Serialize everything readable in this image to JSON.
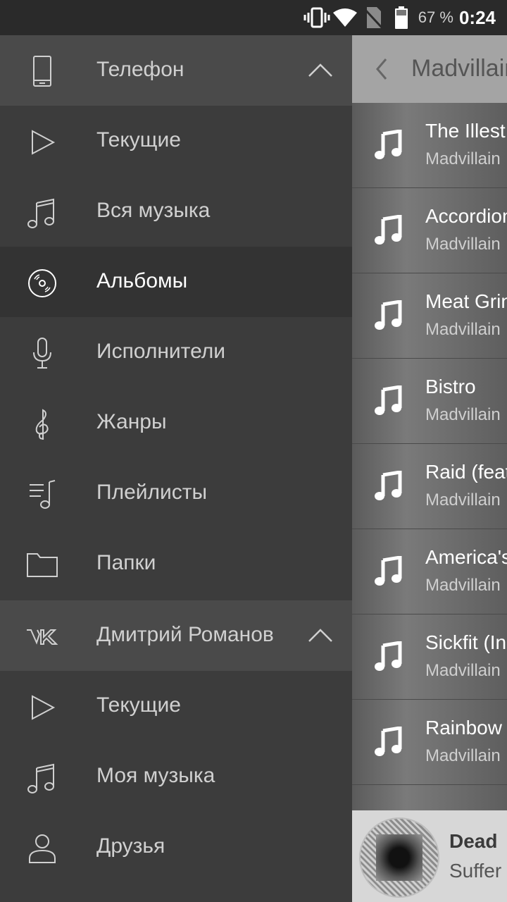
{
  "status_bar": {
    "battery_percent": "67 %",
    "time": "0:24",
    "icons": [
      "vibrate-icon",
      "wifi-icon",
      "no-sim-icon",
      "battery-icon"
    ]
  },
  "background": {
    "toolbar_title": "Madvillain",
    "tracks": [
      {
        "title": "The Illest",
        "artist": "Madvillain"
      },
      {
        "title": "Accordion",
        "artist": "Madvillain"
      },
      {
        "title": "Meat Grinder",
        "artist": "Madvillain"
      },
      {
        "title": "Bistro",
        "artist": "Madvillain"
      },
      {
        "title": "Raid (feat",
        "artist": "Madvillain"
      },
      {
        "title": "America's",
        "artist": "Madvillain"
      },
      {
        "title": "Sickfit (In",
        "artist": "Madvillain"
      },
      {
        "title": "Rainbow",
        "artist": "Madvillain"
      }
    ],
    "mini_player": {
      "title": "Dead",
      "subtitle": "Suffer"
    }
  },
  "drawer": {
    "phone_section": {
      "header": "Телефон",
      "items": [
        {
          "label": "Текущие",
          "icon": "play-icon"
        },
        {
          "label": "Вся музыка",
          "icon": "music-note-icon"
        },
        {
          "label": "Альбомы",
          "icon": "vinyl-icon",
          "selected": true
        },
        {
          "label": "Исполнители",
          "icon": "microphone-icon"
        },
        {
          "label": "Жанры",
          "icon": "treble-clef-icon"
        },
        {
          "label": "Плейлисты",
          "icon": "playlist-icon"
        },
        {
          "label": "Папки",
          "icon": "folder-icon"
        }
      ]
    },
    "vk_section": {
      "header": "Дмитрий Романов",
      "items": [
        {
          "label": "Текущие",
          "icon": "play-icon"
        },
        {
          "label": "Моя музыка",
          "icon": "music-note-icon"
        },
        {
          "label": "Друзья",
          "icon": "person-icon"
        }
      ]
    }
  },
  "colors": {
    "drawer_bg": "#3c3c3c",
    "section_header_bg": "#4a4a4a",
    "selected_bg": "#333333",
    "text_primary": "#d0d0d0",
    "text_selected": "#ffffff"
  }
}
